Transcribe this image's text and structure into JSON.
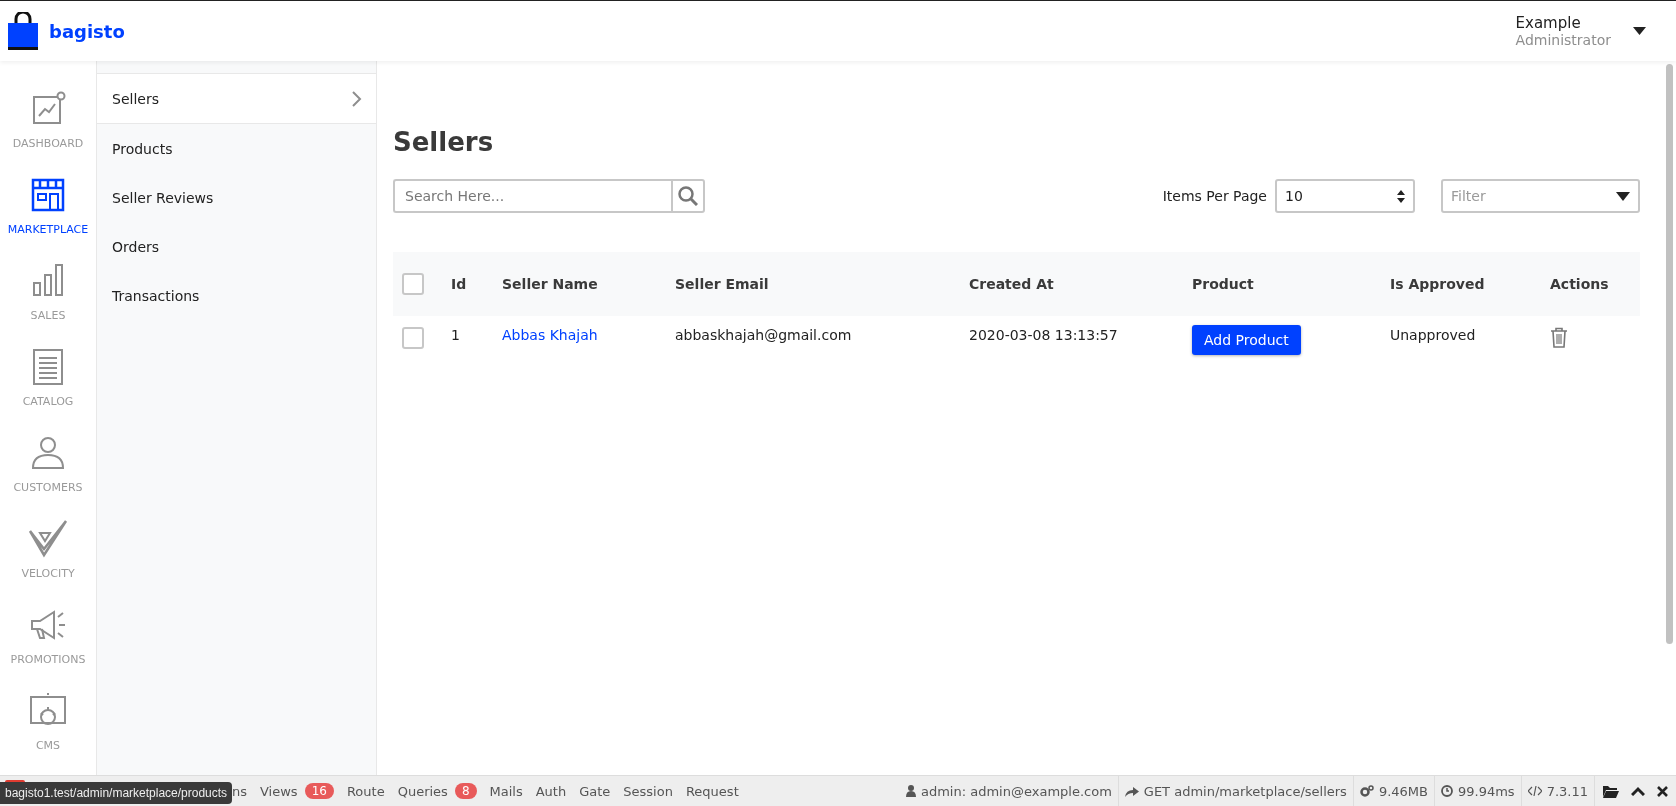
{
  "header": {
    "brand": "bagisto",
    "user_name": "Example",
    "user_role": "Administrator"
  },
  "rail": [
    {
      "label": "DASHBOARD",
      "selected": false
    },
    {
      "label": "MARKETPLACE",
      "selected": true
    },
    {
      "label": "SALES",
      "selected": false
    },
    {
      "label": "CATALOG",
      "selected": false
    },
    {
      "label": "CUSTOMERS",
      "selected": false
    },
    {
      "label": "VELOCITY",
      "selected": false
    },
    {
      "label": "PROMOTIONS",
      "selected": false
    },
    {
      "label": "CMS",
      "selected": false
    }
  ],
  "submenu": [
    {
      "label": "Sellers",
      "selected": true
    },
    {
      "label": "Products",
      "selected": false
    },
    {
      "label": "Seller Reviews",
      "selected": false
    },
    {
      "label": "Orders",
      "selected": false
    },
    {
      "label": "Transactions",
      "selected": false
    }
  ],
  "page_title": "Sellers",
  "search": {
    "placeholder": "Search Here..."
  },
  "items_per_page": {
    "label": "Items Per Page",
    "value": "10"
  },
  "filter": {
    "placeholder": "Filter"
  },
  "table": {
    "select_all_checked": false,
    "columns": [
      "Id",
      "Seller Name",
      "Seller Email",
      "Created At",
      "Product",
      "Is Approved",
      "Actions"
    ],
    "rows": [
      {
        "checked": false,
        "id": "1",
        "seller_name": "Abbas Khajah",
        "seller_email": "abbaskhajah@gmail.com",
        "created_at": "2020-03-08 13:13:57",
        "product_button": "Add Product",
        "is_approved": "Unapproved"
      }
    ]
  },
  "debug_bar": {
    "tabs": [
      {
        "label": "ns"
      },
      {
        "label": "Views",
        "badge": "16"
      },
      {
        "label": "Route"
      },
      {
        "label": "Queries",
        "badge": "8"
      },
      {
        "label": "Mails"
      },
      {
        "label": "Auth"
      },
      {
        "label": "Gate"
      },
      {
        "label": "Session"
      },
      {
        "label": "Request"
      }
    ],
    "user": "admin: admin@example.com",
    "request": "GET admin/marketplace/sellers",
    "memory": "9.46MB",
    "time": "99.94ms",
    "php": "7.3.11"
  },
  "status_url": "bagisto1.test/admin/marketplace/products"
}
